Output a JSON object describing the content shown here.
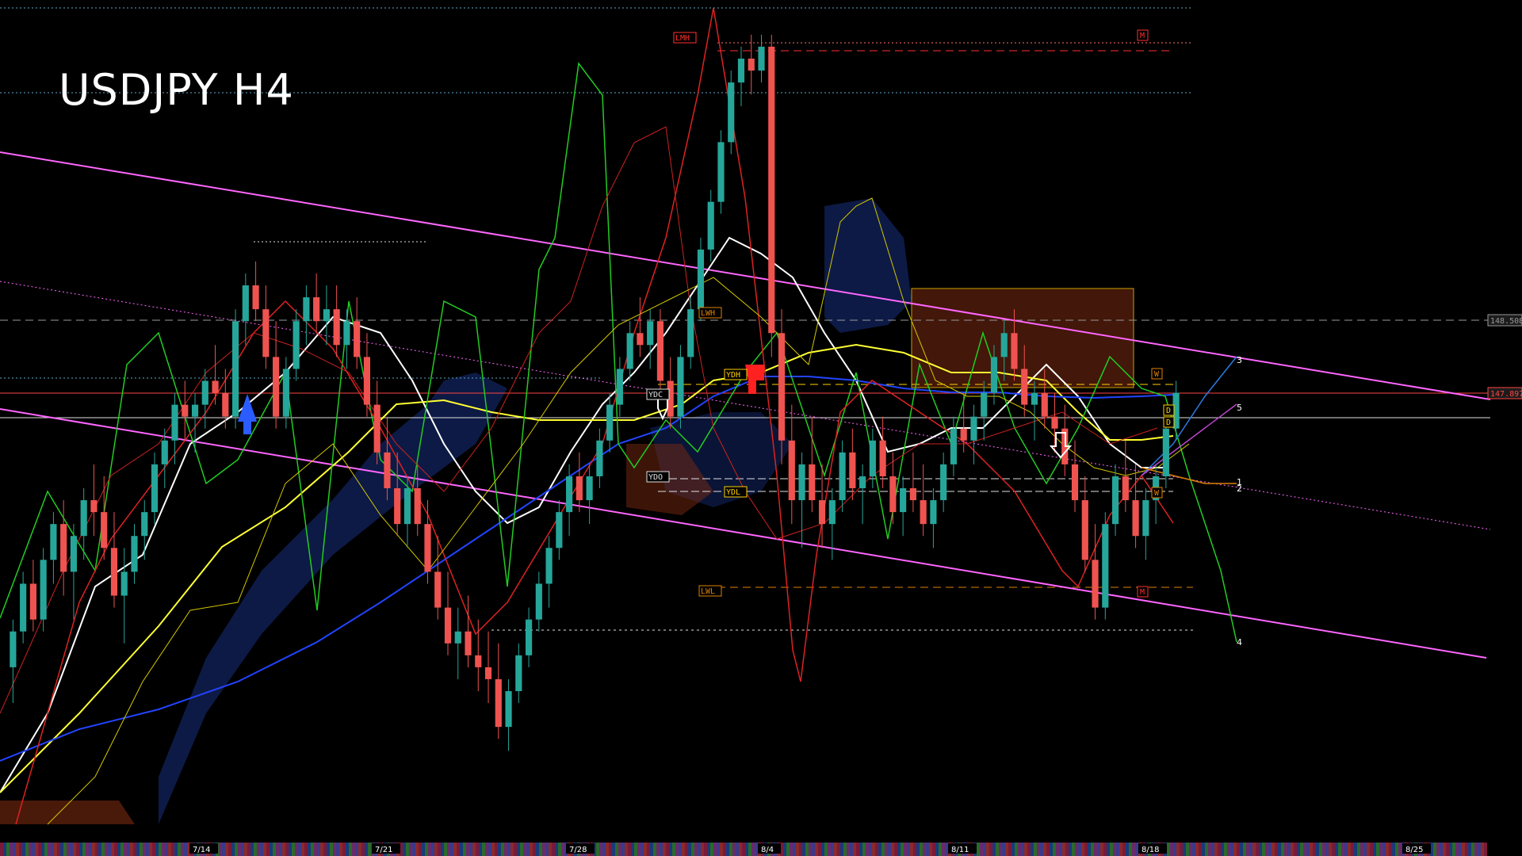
{
  "title": "USDJPY H4",
  "chart_data": {
    "type": "candlestick",
    "symbol": "USDJPY",
    "timeframe": "H4",
    "price_labels": [
      {
        "text": "148.508",
        "price": 148.508,
        "color": "#9a9a9a"
      },
      {
        "text": "147.897",
        "price": 147.897,
        "color": "#ff4444"
      }
    ],
    "date_labels": [
      "7/14",
      "7/21",
      "7/28",
      "8/4",
      "8/11",
      "8/18",
      "8/25"
    ],
    "level_labels": [
      "LMH",
      "LWH",
      "YDH",
      "YDC",
      "YDO",
      "YDL",
      "LWL"
    ],
    "markers": [
      "M",
      "M",
      "W",
      "W",
      "D",
      "D"
    ],
    "projection_labels": [
      "3",
      "5",
      "1",
      "2",
      "4"
    ],
    "candles_ohlc": [
      [
        145.6,
        146.0,
        145.3,
        145.9
      ],
      [
        145.9,
        146.4,
        145.8,
        146.3
      ],
      [
        146.3,
        146.5,
        145.9,
        146.0
      ],
      [
        146.0,
        146.6,
        145.9,
        146.5
      ],
      [
        146.5,
        146.9,
        146.3,
        146.8
      ],
      [
        146.8,
        147.0,
        146.2,
        146.4
      ],
      [
        146.4,
        146.8,
        146.0,
        146.7
      ],
      [
        146.7,
        147.1,
        146.5,
        147.0
      ],
      [
        147.0,
        147.3,
        146.7,
        146.9
      ],
      [
        146.9,
        147.2,
        146.5,
        146.6
      ],
      [
        146.6,
        146.9,
        146.1,
        146.2
      ],
      [
        146.2,
        146.6,
        145.8,
        146.4
      ],
      [
        146.4,
        146.8,
        146.3,
        146.7
      ],
      [
        146.7,
        147.0,
        146.5,
        146.9
      ],
      [
        146.9,
        147.4,
        146.8,
        147.3
      ],
      [
        147.3,
        147.6,
        147.1,
        147.5
      ],
      [
        147.5,
        147.9,
        147.3,
        147.8
      ],
      [
        147.8,
        148.0,
        147.5,
        147.7
      ],
      [
        147.7,
        147.9,
        147.4,
        147.8
      ],
      [
        147.8,
        148.1,
        147.6,
        148.0
      ],
      [
        148.0,
        148.3,
        147.8,
        147.9
      ],
      [
        147.9,
        148.1,
        147.6,
        147.7
      ],
      [
        147.7,
        148.6,
        147.6,
        148.5
      ],
      [
        148.5,
        148.9,
        148.3,
        148.8
      ],
      [
        148.8,
        149.0,
        148.5,
        148.6
      ],
      [
        148.6,
        148.8,
        148.1,
        148.2
      ],
      [
        148.2,
        148.5,
        147.6,
        147.7
      ],
      [
        147.7,
        148.2,
        147.6,
        148.1
      ],
      [
        148.1,
        148.6,
        148.0,
        148.5
      ],
      [
        148.5,
        148.8,
        148.3,
        148.7
      ],
      [
        148.7,
        148.9,
        148.4,
        148.5
      ],
      [
        148.5,
        148.8,
        148.3,
        148.6
      ],
      [
        148.6,
        148.8,
        148.2,
        148.3
      ],
      [
        148.3,
        148.6,
        148.1,
        148.5
      ],
      [
        148.5,
        148.7,
        148.1,
        148.2
      ],
      [
        148.2,
        148.4,
        147.7,
        147.8
      ],
      [
        147.8,
        148.0,
        147.3,
        147.4
      ],
      [
        147.4,
        147.7,
        147.0,
        147.1
      ],
      [
        147.1,
        147.4,
        146.7,
        146.8
      ],
      [
        146.8,
        147.2,
        146.6,
        147.1
      ],
      [
        147.1,
        147.3,
        146.7,
        146.8
      ],
      [
        146.8,
        147.0,
        146.3,
        146.4
      ],
      [
        146.4,
        146.7,
        146.0,
        146.1
      ],
      [
        146.1,
        146.4,
        145.7,
        145.8
      ],
      [
        145.8,
        146.1,
        145.5,
        145.9
      ],
      [
        145.9,
        146.2,
        145.6,
        145.7
      ],
      [
        145.7,
        146.0,
        145.4,
        145.6
      ],
      [
        145.6,
        145.9,
        145.3,
        145.5
      ],
      [
        145.5,
        145.8,
        145.0,
        145.1
      ],
      [
        145.1,
        145.5,
        144.9,
        145.4
      ],
      [
        145.4,
        145.8,
        145.3,
        145.7
      ],
      [
        145.7,
        146.1,
        145.6,
        146.0
      ],
      [
        146.0,
        146.4,
        145.9,
        146.3
      ],
      [
        146.3,
        146.7,
        146.1,
        146.6
      ],
      [
        146.6,
        147.0,
        146.5,
        146.9
      ],
      [
        146.9,
        147.3,
        146.7,
        147.2
      ],
      [
        147.2,
        147.4,
        146.9,
        147.0
      ],
      [
        147.0,
        147.3,
        146.8,
        147.2
      ],
      [
        147.2,
        147.6,
        147.1,
        147.5
      ],
      [
        147.5,
        147.9,
        147.4,
        147.8
      ],
      [
        147.8,
        148.2,
        147.7,
        148.1
      ],
      [
        148.1,
        148.5,
        148.0,
        148.4
      ],
      [
        148.4,
        148.7,
        148.2,
        148.3
      ],
      [
        148.3,
        148.6,
        148.1,
        148.5
      ],
      [
        148.5,
        148.6,
        147.9,
        148.0
      ],
      [
        148.0,
        148.2,
        147.6,
        147.7
      ],
      [
        147.7,
        148.3,
        147.6,
        148.2
      ],
      [
        148.2,
        148.7,
        148.1,
        148.6
      ],
      [
        148.6,
        149.2,
        148.5,
        149.1
      ],
      [
        149.1,
        149.6,
        149.0,
        149.5
      ],
      [
        149.5,
        150.1,
        149.4,
        150.0
      ],
      [
        150.0,
        150.6,
        149.9,
        150.5
      ],
      [
        150.5,
        150.8,
        150.3,
        150.7
      ],
      [
        150.7,
        150.9,
        150.4,
        150.6
      ],
      [
        150.6,
        150.9,
        150.5,
        150.8
      ],
      [
        150.8,
        150.9,
        148.2,
        148.4
      ],
      [
        148.4,
        148.6,
        147.3,
        147.5
      ],
      [
        147.5,
        147.8,
        146.8,
        147.0
      ],
      [
        147.0,
        147.4,
        146.6,
        147.3
      ],
      [
        147.3,
        147.7,
        146.9,
        147.0
      ],
      [
        147.0,
        147.3,
        146.6,
        146.8
      ],
      [
        146.8,
        147.1,
        146.5,
        147.0
      ],
      [
        147.0,
        147.5,
        146.9,
        147.4
      ],
      [
        147.4,
        147.6,
        147.0,
        147.1
      ],
      [
        147.1,
        147.3,
        146.8,
        147.2
      ],
      [
        147.2,
        147.6,
        147.1,
        147.5
      ],
      [
        147.5,
        147.7,
        147.1,
        147.2
      ],
      [
        147.2,
        147.4,
        146.8,
        146.9
      ],
      [
        146.9,
        147.2,
        146.7,
        147.1
      ],
      [
        147.1,
        147.4,
        146.9,
        147.0
      ],
      [
        147.0,
        147.3,
        146.7,
        146.8
      ],
      [
        146.8,
        147.1,
        146.6,
        147.0
      ],
      [
        147.0,
        147.4,
        146.9,
        147.3
      ],
      [
        147.3,
        147.7,
        147.2,
        147.6
      ],
      [
        147.6,
        147.9,
        147.4,
        147.5
      ],
      [
        147.5,
        147.8,
        147.3,
        147.7
      ],
      [
        147.7,
        148.0,
        147.5,
        147.9
      ],
      [
        147.9,
        148.3,
        147.8,
        148.2
      ],
      [
        148.2,
        148.5,
        148.0,
        148.4
      ],
      [
        148.4,
        148.6,
        148.0,
        148.1
      ],
      [
        148.1,
        148.3,
        147.7,
        147.8
      ],
      [
        147.8,
        148.0,
        147.5,
        147.9
      ],
      [
        147.9,
        148.1,
        147.6,
        147.7
      ],
      [
        147.7,
        147.9,
        147.4,
        147.6
      ],
      [
        147.6,
        147.8,
        147.2,
        147.3
      ],
      [
        147.3,
        147.5,
        146.9,
        147.0
      ],
      [
        147.0,
        147.2,
        146.4,
        146.5
      ],
      [
        146.5,
        146.8,
        146.0,
        146.1
      ],
      [
        146.1,
        146.9,
        146.0,
        146.8
      ],
      [
        146.8,
        147.3,
        146.7,
        147.2
      ],
      [
        147.2,
        147.5,
        146.9,
        147.0
      ],
      [
        147.0,
        147.3,
        146.6,
        146.7
      ],
      [
        146.7,
        147.1,
        146.5,
        147.0
      ],
      [
        147.0,
        147.3,
        146.8,
        147.2
      ],
      [
        147.2,
        147.7,
        147.1,
        147.6
      ],
      [
        147.6,
        148.0,
        147.5,
        147.9
      ]
    ]
  }
}
